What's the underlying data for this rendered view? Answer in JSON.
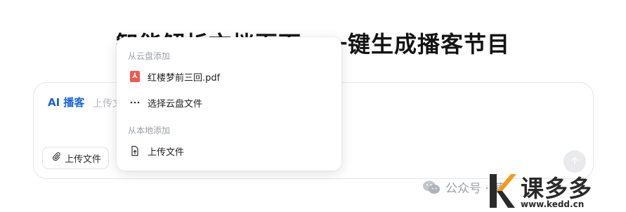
{
  "page": {
    "title": "智能解析文档页面，一键生成播客节目"
  },
  "composer": {
    "ai_badge": "AI 播客",
    "placeholder": "上传文档、网页、图片，或支持直接输入文本来生成",
    "upload_label": "上传文件"
  },
  "dropdown": {
    "cloud_section": "从云盘添加",
    "cloud_file": "红楼梦前三回.pdf",
    "choose_cloud": "选择云盘文件",
    "local_section": "从本地添加",
    "upload_local": "上传文件"
  },
  "watermark": {
    "text": "公众号 · 萝"
  },
  "brand": {
    "name": "课多多",
    "url": "www.kedd.cn"
  },
  "colors": {
    "accent": "#1a63d8",
    "pdf": "#ef5a4c",
    "brand_orange": "#f39a1e"
  }
}
